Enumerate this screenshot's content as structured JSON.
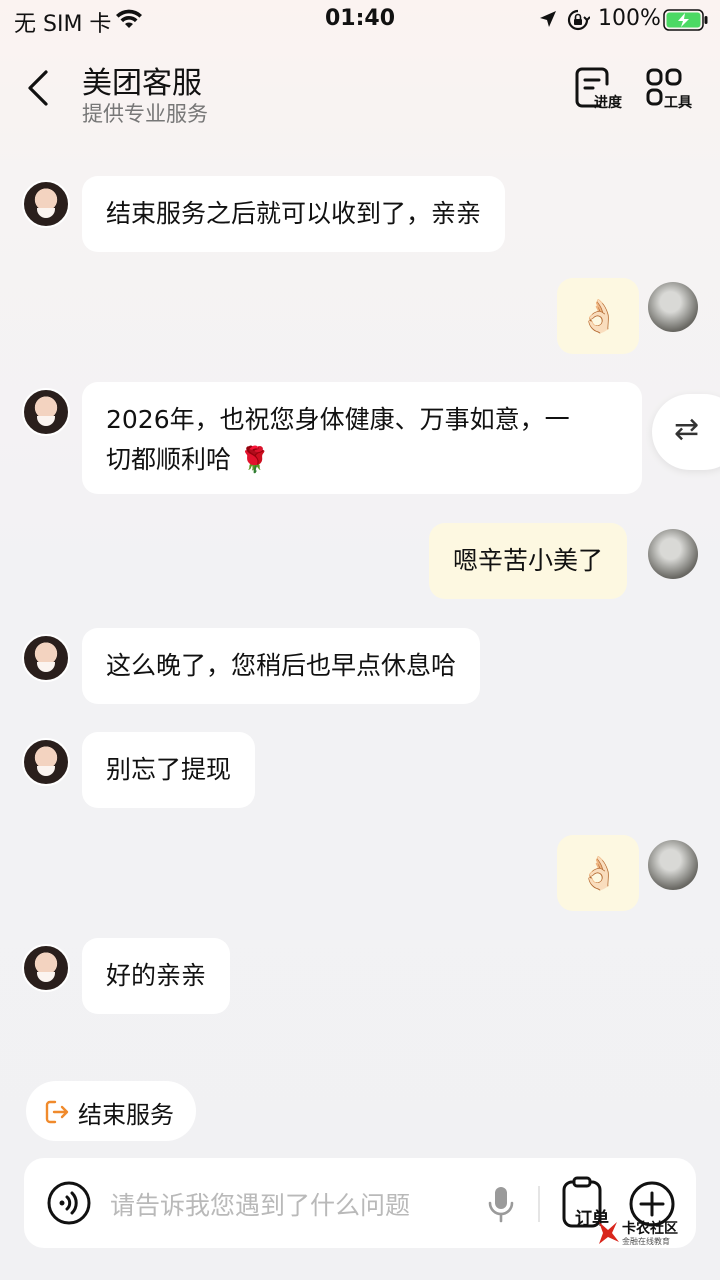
{
  "status_bar": {
    "carrier": "无 SIM 卡",
    "time": "01:40",
    "battery": "100%"
  },
  "header": {
    "title": "美团客服",
    "subtitle": "提供专业服务",
    "progress_label": "进度",
    "tools_label": "工具"
  },
  "messages": [
    {
      "from": "agent",
      "text": "结束服务之后就可以收到了，亲亲"
    },
    {
      "from": "user",
      "text": "👌🏻"
    },
    {
      "from": "agent",
      "line1": "2026年，也祝您身体健康、万事如意，一",
      "line2": "切都顺利哈 🌹"
    },
    {
      "from": "user",
      "text": "嗯辛苦小美了"
    },
    {
      "from": "agent",
      "text": "这么晚了，您稍后也早点休息哈"
    },
    {
      "from": "agent",
      "text": "别忘了提现"
    },
    {
      "from": "user",
      "text": "👌🏻"
    },
    {
      "from": "agent",
      "text": "好的亲亲"
    }
  ],
  "side_toggle": "⇄",
  "end_service": "结束服务",
  "input": {
    "placeholder": "请告诉我您遇到了什么问题",
    "order_label": "订单"
  },
  "watermark": {
    "title": "卡农社区",
    "subtitle": "金融在线教育"
  },
  "colors": {
    "accent": "#f08a2c",
    "user_bubble": "#fdf8e1",
    "agent_bubble": "#ffffff",
    "battery_green": "#4cd964"
  },
  "icons": [
    "back-icon",
    "wifi-icon",
    "location-icon",
    "lock-icon",
    "battery-icon",
    "progress-icon",
    "tools-icon",
    "swap-icon",
    "exit-icon",
    "voice-icon",
    "mic-icon",
    "order-icon",
    "plus-icon"
  ]
}
